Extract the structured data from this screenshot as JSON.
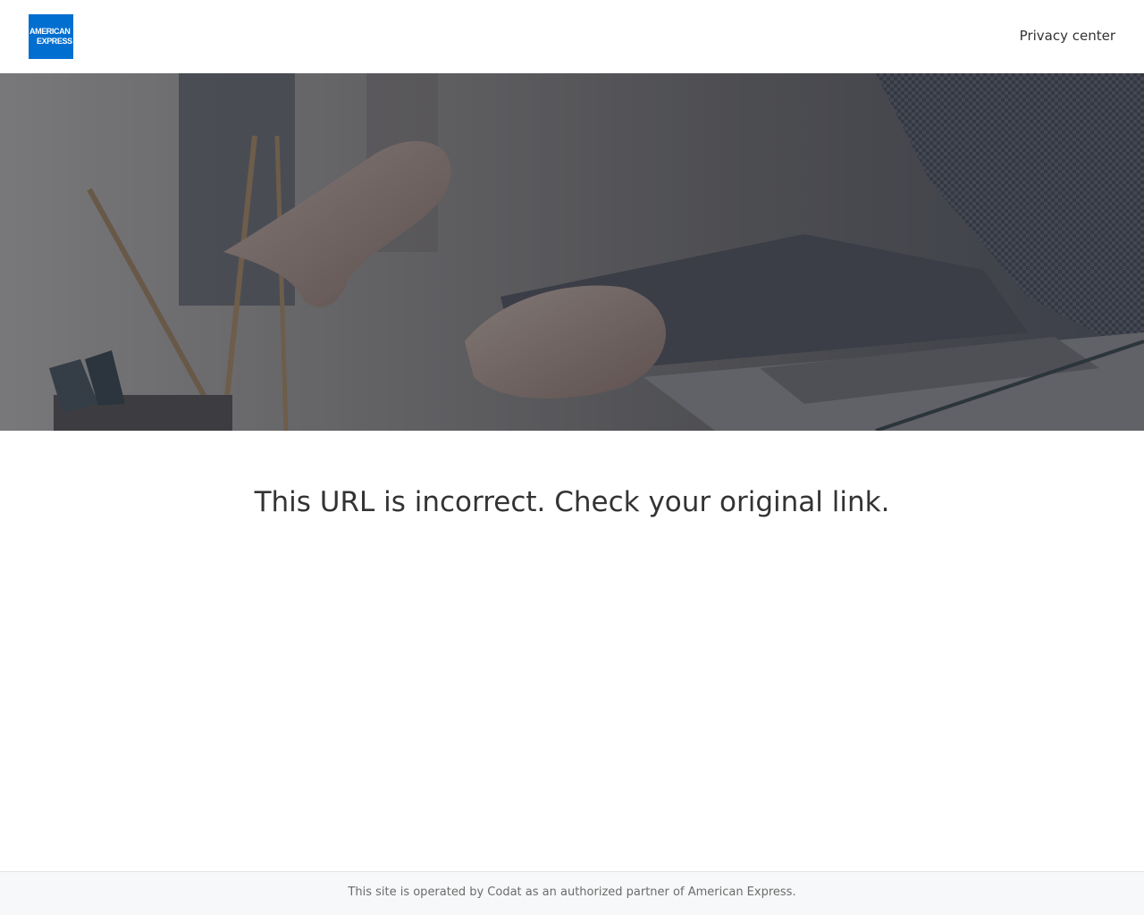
{
  "header": {
    "logo": {
      "line1": "AMERICAN",
      "line2": "EXPRESS",
      "color": "#016fd0"
    },
    "privacy_link": "Privacy center"
  },
  "hero": {
    "overlay_color": "#2a2f3a"
  },
  "main": {
    "message": "This URL is incorrect. Check your original link."
  },
  "footer": {
    "text": "This site is operated by Codat as an authorized partner of American Express."
  }
}
